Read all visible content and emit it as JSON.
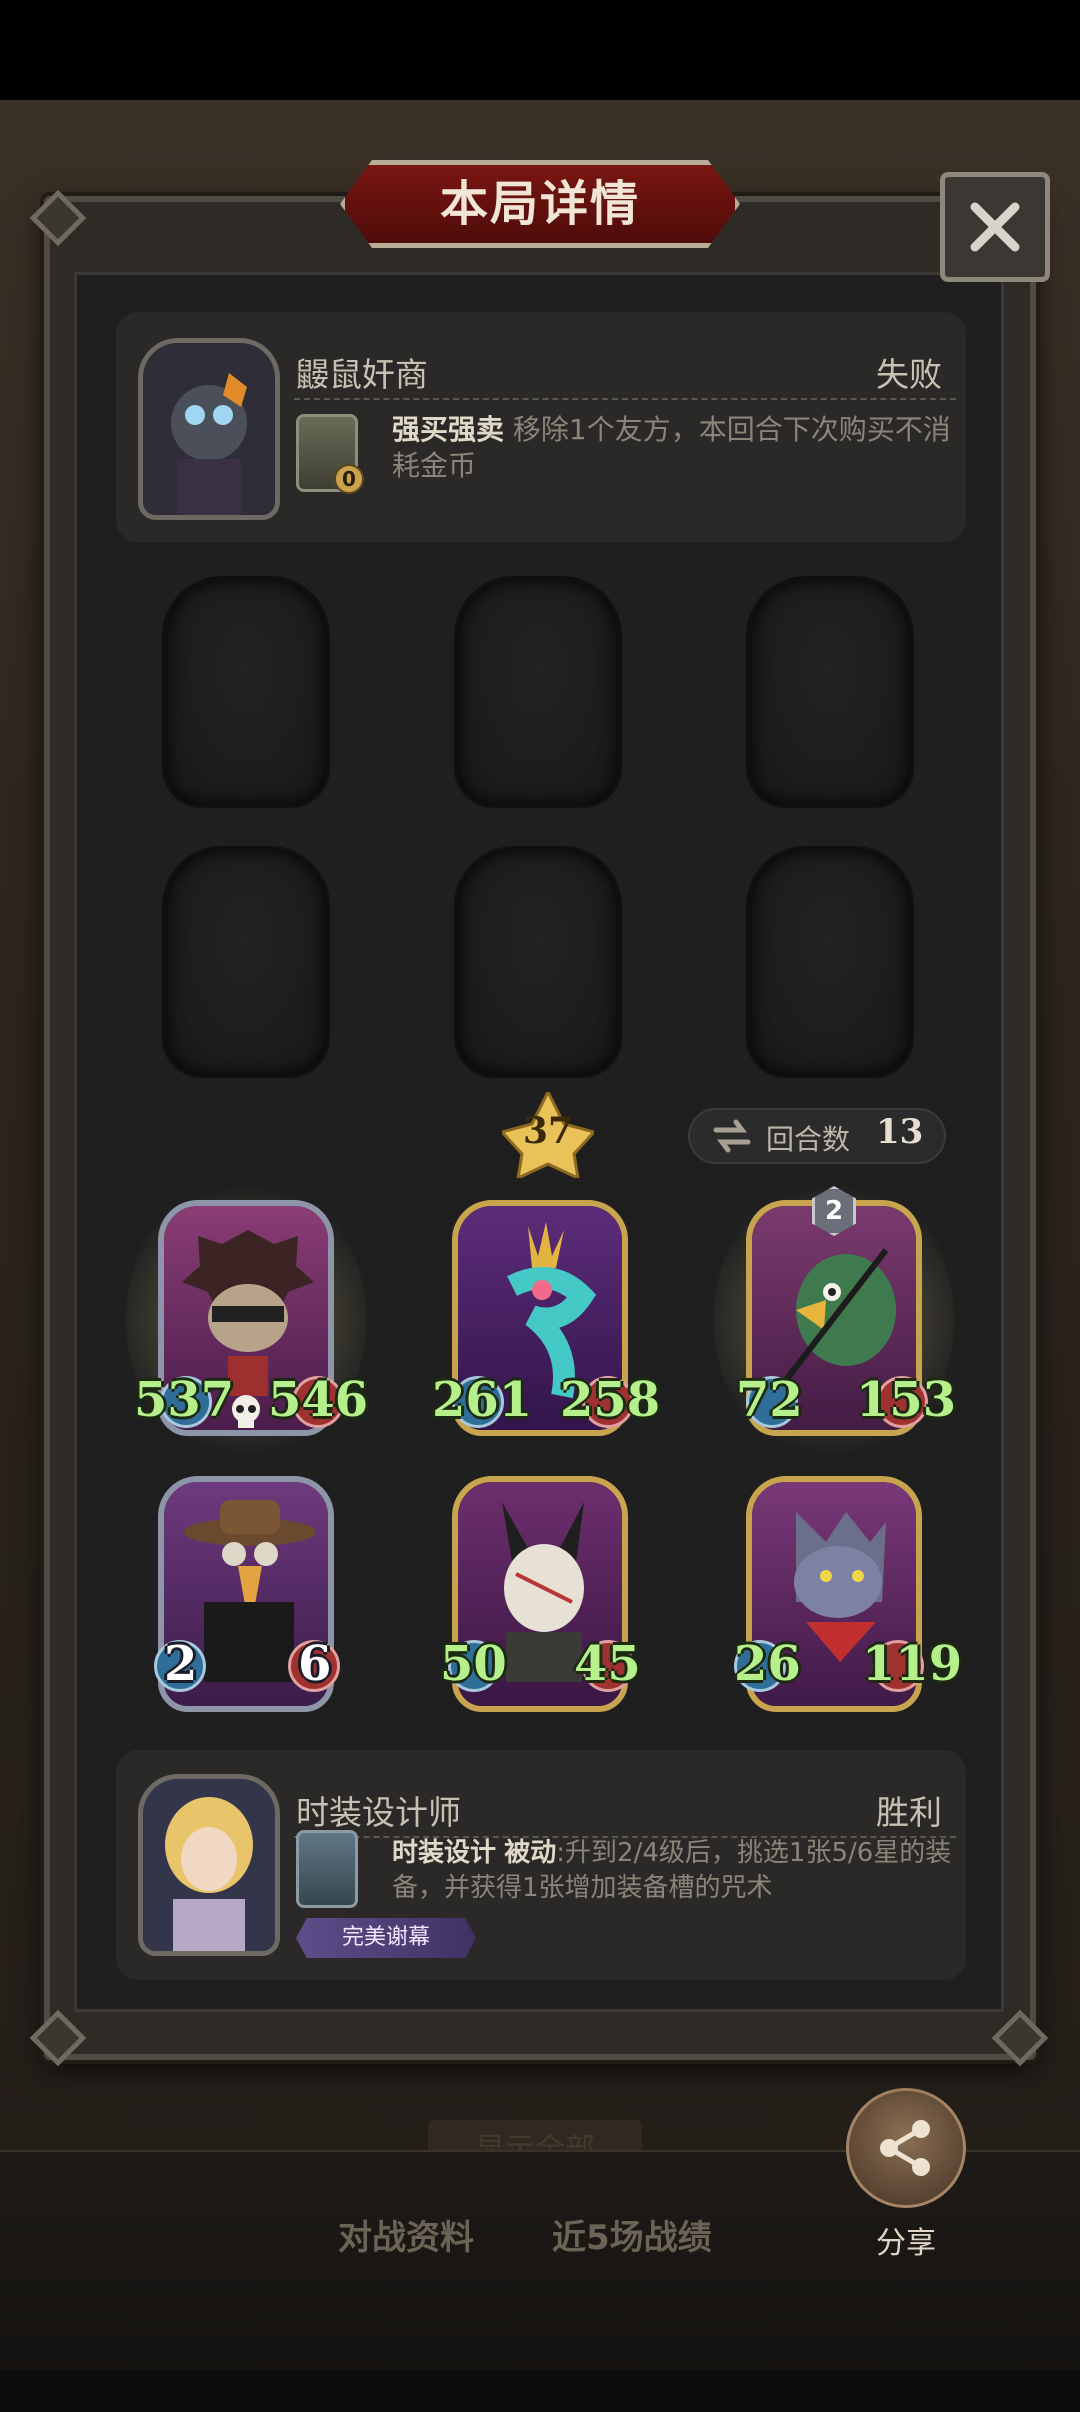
{
  "header": {
    "title": "本局详情"
  },
  "close": {
    "icon": "close-icon"
  },
  "player_top": {
    "name": "鼹鼠奸商",
    "result": "失败",
    "skill_name": "强买强卖",
    "skill_desc": " 移除1个友方，本回合下次购买不消耗金币",
    "coin_value": "0"
  },
  "board": {
    "level": "37",
    "rounds_label": "回合数",
    "rounds_value": "13",
    "units": [
      {
        "name": "hedgehog-bandit",
        "atk": "537",
        "hp": "546",
        "frame": "silver",
        "glow": true
      },
      {
        "name": "crowned-serpent",
        "atk": "261",
        "hp": "258",
        "frame": "gold",
        "glow": false
      },
      {
        "name": "green-eagle",
        "atk": "72",
        "hp": "153",
        "frame": "gold",
        "glow": true,
        "star": "2"
      },
      {
        "name": "plague-doctor",
        "atk": "2",
        "hp": "6",
        "frame": "silver",
        "white_stats": true
      },
      {
        "name": "masked-rabbit",
        "atk": "50",
        "hp": "45",
        "frame": "gold"
      },
      {
        "name": "gray-wolf",
        "atk": "26",
        "hp": "119",
        "frame": "gold"
      }
    ]
  },
  "player_bottom": {
    "name": "时装设计师",
    "result": "胜利",
    "skill_name": "时装设计",
    "skill_tag": "被动",
    "skill_desc": ":升到2/4级后，挑选1张5/6星的装备，并获得1张增加装备槽的咒术",
    "badge": "完美谢幕"
  },
  "footer": {
    "show_all": "显示全部",
    "tab_battle_info": "对战资料",
    "tab_recent": "近5场战绩",
    "share_label": "分享"
  },
  "colors": {
    "title_plate": "#7a1612",
    "panel": "#2e2b27",
    "stat_green": "#b6f08c",
    "gold_frame": "#c9a44e"
  }
}
